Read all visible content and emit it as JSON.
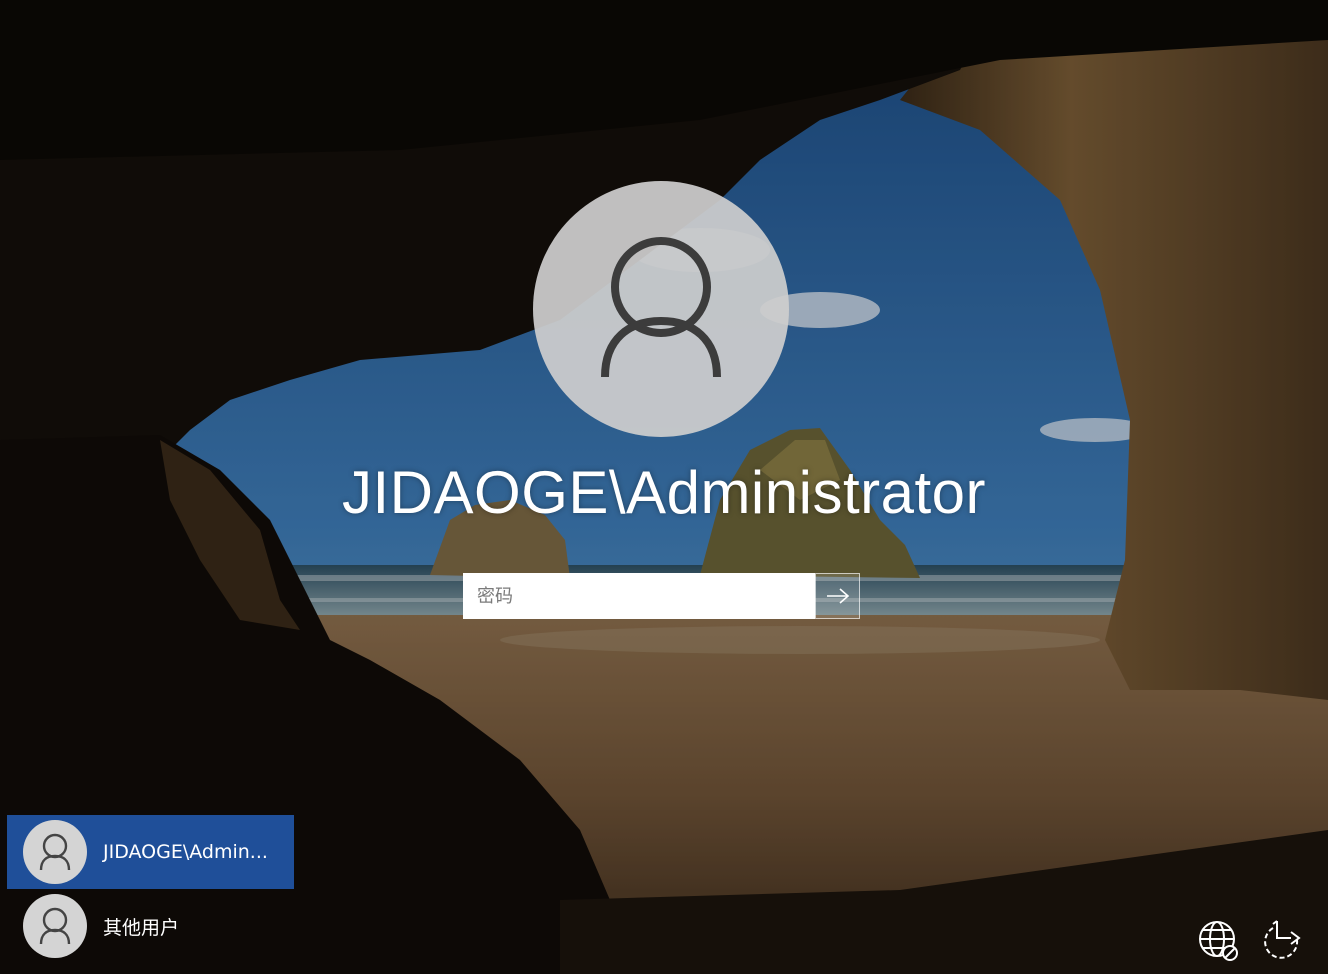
{
  "login": {
    "username": "JIDAOGE\\Administrator",
    "password_placeholder": "密码"
  },
  "users": [
    {
      "label": "JIDAOGE\\Admin...",
      "selected": true
    },
    {
      "label": "其他用户",
      "selected": false
    }
  ],
  "icons": {
    "avatar": "user-icon",
    "submit": "arrow-right-icon",
    "network": "network-globe-icon",
    "accessibility": "ease-of-access-icon"
  },
  "colors": {
    "selected_tile": "#1f4f99",
    "avatar_bg": "#cdcdcd"
  }
}
